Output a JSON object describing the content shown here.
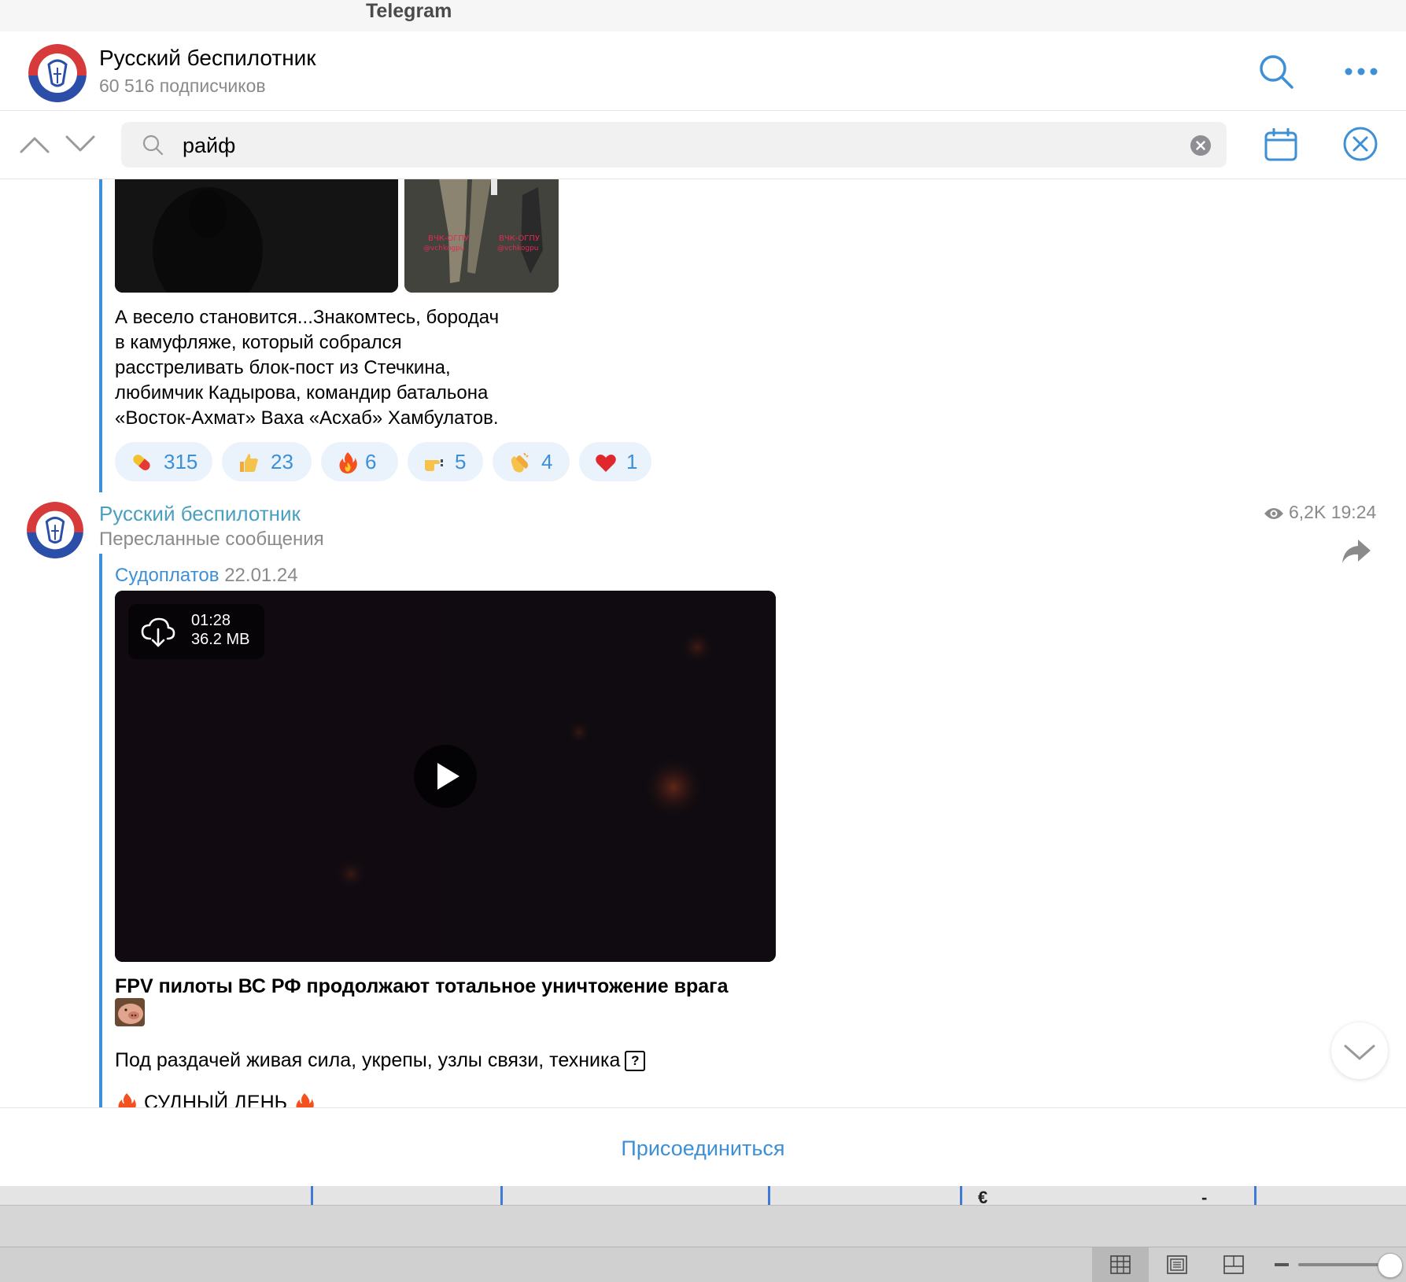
{
  "window": {
    "title": "Telegram"
  },
  "channel": {
    "name": "Русский беспилотник",
    "subscribers": "60 516 подписчиков",
    "header_icons": {
      "search": "search-icon",
      "more": "more-dots-icon"
    }
  },
  "search": {
    "query": "райф",
    "icons": {
      "up": "chevron-up-icon",
      "down": "chevron-down-icon",
      "magnifier": "search-icon",
      "clear": "clear-icon",
      "calendar": "calendar-icon",
      "close": "close-icon"
    }
  },
  "post1": {
    "photo_watermark": "ВЧК-ОГПУ",
    "photo_watermark_handle": "@vchkogpu",
    "caption_lines": [
      "А весело становится...Знакомтесь, бородач",
      "в камуфляже, который собрался",
      "расстреливать блок-пост из Стечкина,",
      "любимчик Кадырова, командир батальона",
      "«Восток-Ахмат» Ваха «Асхаб» Хамбулатов."
    ],
    "reactions": [
      {
        "icon": "pill-icon",
        "count": "315"
      },
      {
        "icon": "thumbs-up-icon",
        "count": "23"
      },
      {
        "icon": "fire-icon",
        "count": "6"
      },
      {
        "icon": "pointing-hand-icon",
        "count": "5"
      },
      {
        "icon": "clapping-hands-icon",
        "count": "4"
      },
      {
        "icon": "heart-icon",
        "count": "1"
      }
    ]
  },
  "post2": {
    "author": "Русский беспилотник",
    "forward_label": "Пересланные сообщения",
    "views": "6,2K",
    "time": "19:24",
    "forward_source": "Судоплатов",
    "forward_date": "22.01.24",
    "video": {
      "duration": "01:28",
      "size": "36.2 MB"
    },
    "title": "FPV пилоты ВС РФ продолжают тотальное уничтожение врага",
    "line2": "Под раздачей живая сила, укрепы, узлы связи, техника",
    "line3": "СУДНЫЙ ДЕНЬ"
  },
  "join_button": "Присоединиться",
  "colors": {
    "accent": "#3d8fd6",
    "author": "#4a9fbf",
    "muted": "#8a8a8a",
    "reaction_bg": "#eaf2fb"
  },
  "background_app": {
    "fragments": [
      "€",
      "-"
    ]
  }
}
